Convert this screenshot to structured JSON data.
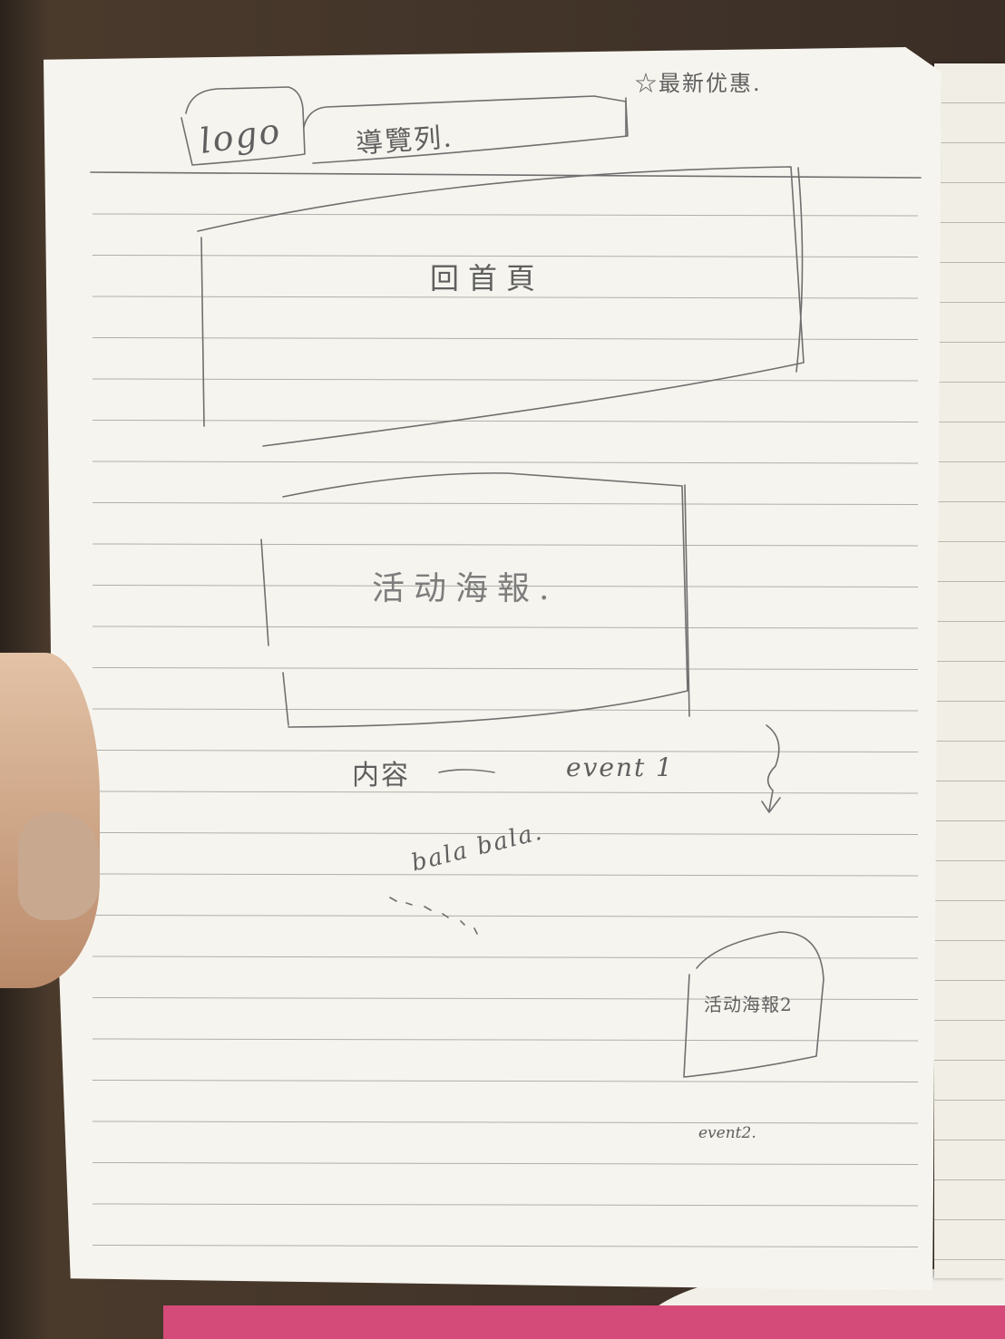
{
  "sketch": {
    "logo": "logo",
    "navbar": "導覽列.",
    "promo": "☆最新优惠.",
    "home": "回首頁",
    "poster1": "活动海報.",
    "content_label": "内容",
    "event1": "event 1",
    "bala": "bala bala.",
    "poster2": "活动海報2",
    "event2": "event2."
  }
}
